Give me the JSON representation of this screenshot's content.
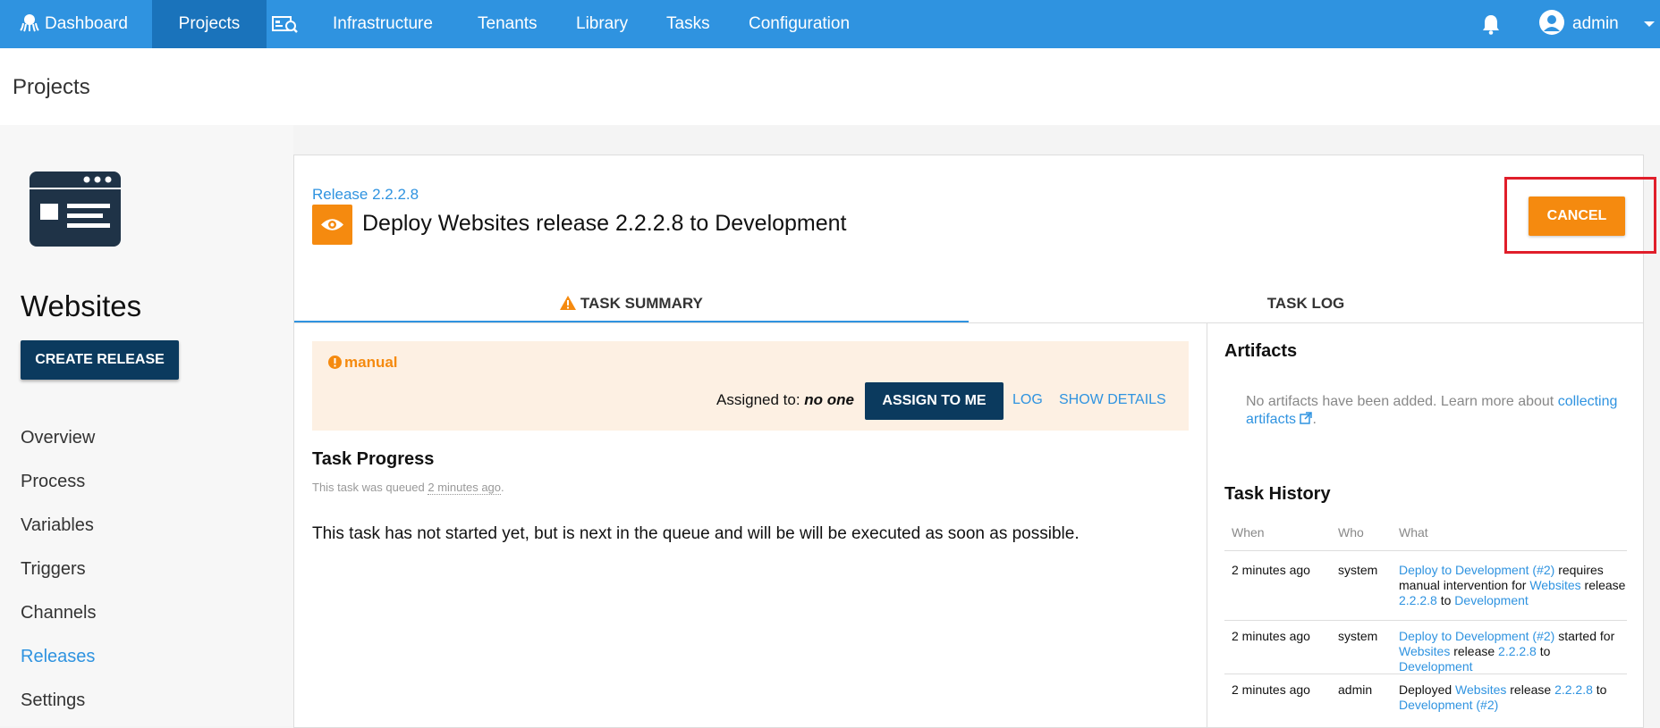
{
  "topnav": {
    "dashboard": "Dashboard",
    "projects": "Projects",
    "infrastructure": "Infrastructure",
    "tenants": "Tenants",
    "library": "Library",
    "tasks": "Tasks",
    "configuration": "Configuration",
    "user": "admin"
  },
  "page_title": "Projects",
  "sidebar": {
    "project_name": "Websites",
    "create_release": "CREATE RELEASE",
    "links": [
      "Overview",
      "Process",
      "Variables",
      "Triggers",
      "Channels",
      "Releases",
      "Settings"
    ]
  },
  "task": {
    "release_link": "Release 2.2.2.8",
    "title": "Deploy Websites release 2.2.2.8 to Development",
    "cancel": "CANCEL",
    "tabs": [
      "TASK SUMMARY",
      "TASK LOG"
    ],
    "manual_label": "manual",
    "assigned_prefix": "Assigned to:",
    "assigned_value": "no one",
    "assign_btn": "ASSIGN TO ME",
    "log_link": "LOG",
    "details_link": "SHOW DETAILS",
    "progress_title": "Task Progress",
    "queued_prefix": "This task was queued",
    "queued_time": "2 minutes ago",
    "queued_suffix": ".",
    "not_started": "This task has not started yet, but is next in the queue and will be will be executed as soon as possible."
  },
  "artifacts": {
    "title": "Artifacts",
    "text": "No artifacts have been added. Learn more about",
    "link": "collecting artifacts",
    "period": "."
  },
  "history": {
    "title": "Task History",
    "headers": [
      "When",
      "Who",
      "What"
    ],
    "rows": [
      {
        "when": "2 minutes ago",
        "who": "system",
        "what_link1": "Deploy to Development (#2)",
        "what_text1": " requires manual intervention for ",
        "what_link2": "Websites",
        "what_text2": " release ",
        "what_link3": "2.2.2.8",
        "what_text3": " to ",
        "what_link4": "Development"
      },
      {
        "when": "2 minutes ago",
        "who": "system",
        "what_link1": "Deploy to Development (#2)",
        "what_text1": " started for ",
        "what_link2": "Websites",
        "what_text2": " release ",
        "what_link3": "2.2.2.8",
        "what_text3": " to ",
        "what_link4": "Development"
      },
      {
        "when": "2 minutes ago",
        "who": "admin",
        "what_text0": "Deployed ",
        "what_link2": "Websites",
        "what_text2": " release ",
        "what_link3": "2.2.2.8",
        "what_text3": " to ",
        "what_link4": "Development (#2)"
      }
    ]
  },
  "colors": {
    "nav_blue": "#2f93e0",
    "nav_active": "#1a73bb",
    "dark_button": "#0b3a5e",
    "orange": "#f58a0f",
    "highlight_red": "#e01e2a"
  }
}
